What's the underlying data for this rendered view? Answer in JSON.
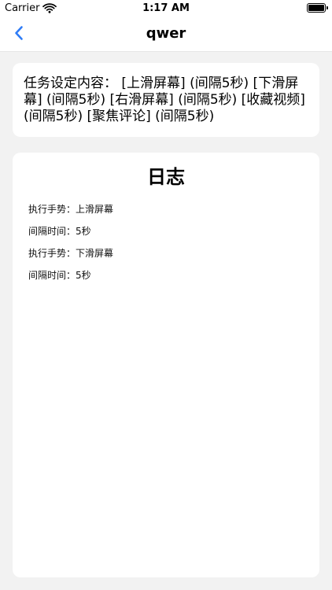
{
  "status_bar": {
    "carrier": "Carrier",
    "time": "1:17 AM",
    "wifi_icon": "wifi-icon",
    "battery_icon": "battery-icon"
  },
  "nav": {
    "title": "qwer",
    "back_icon": "chevron-left-icon",
    "accent": "#2f7cf6"
  },
  "task": {
    "text": "任务设定内容：  [上滑屏幕]  (间隔5秒)  [下滑屏幕]  (间隔5秒)  [右滑屏幕]  (间隔5秒)  [收藏视频]  (间隔5秒)  [聚焦评论]  (间隔5秒)"
  },
  "log": {
    "title": "日志",
    "lines": [
      "执行手势：上滑屏幕",
      "间隔时间：5秒",
      "执行手势：下滑屏幕",
      "间隔时间：5秒"
    ]
  }
}
